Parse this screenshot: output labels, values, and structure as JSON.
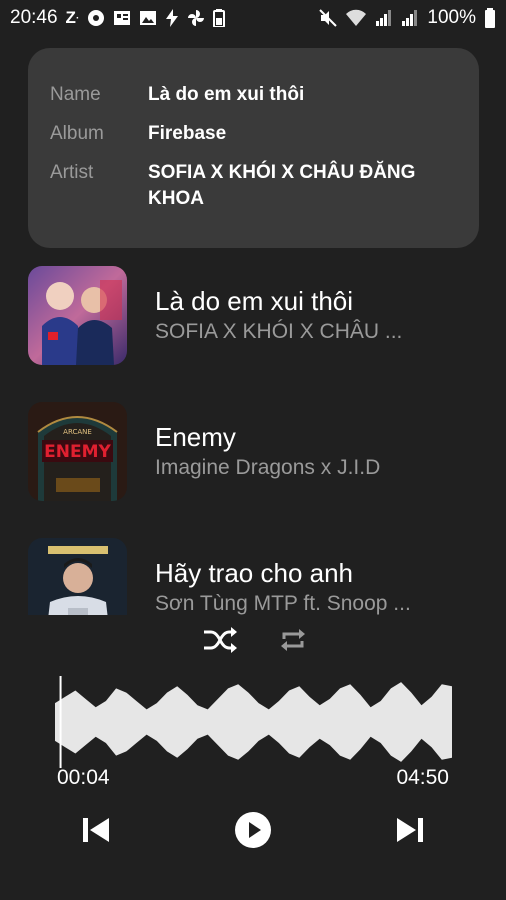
{
  "status_bar": {
    "time": "20:46",
    "battery": "100%",
    "icons_left": [
      "z-notification-icon",
      "circle-app-icon",
      "news-icon",
      "gallery-icon",
      "flash-icon",
      "pinwheel-icon",
      "battery-saver-icon"
    ],
    "icons_right": [
      "mute-icon",
      "wifi-icon",
      "signal-icon",
      "signal-icon"
    ]
  },
  "info_card": {
    "name_label": "Name",
    "name_value": "Là do em xui thôi",
    "album_label": "Album",
    "album_value": "Firebase",
    "artist_label": "Artist",
    "artist_value": "SOFIA X KHÓI X CHÂU ĐĂNG KHOA"
  },
  "songs": [
    {
      "title": "Là do em xui thôi",
      "artist": "SOFIA X KHÓI X CHÂU ...",
      "cover": "la-do-em-xui-thoi-cover"
    },
    {
      "title": "Enemy",
      "artist": "Imagine Dragons x J.I.D",
      "cover": "enemy-arcane-cover",
      "cover_text": "ENEMY",
      "cover_subtext": "ARCANE"
    },
    {
      "title": "Hãy trao cho anh",
      "artist": "Sơn Tùng MTP ft. Snoop ...",
      "cover": "hay-trao-cho-anh-cover"
    }
  ],
  "player": {
    "elapsed": "00:04",
    "duration": "04:50",
    "progress": 0.014,
    "shuffle_icon": "shuffle-icon",
    "repeat_icon": "repeat-icon",
    "prev_icon": "skip-previous-icon",
    "play_icon": "play-icon",
    "next_icon": "skip-next-icon"
  }
}
